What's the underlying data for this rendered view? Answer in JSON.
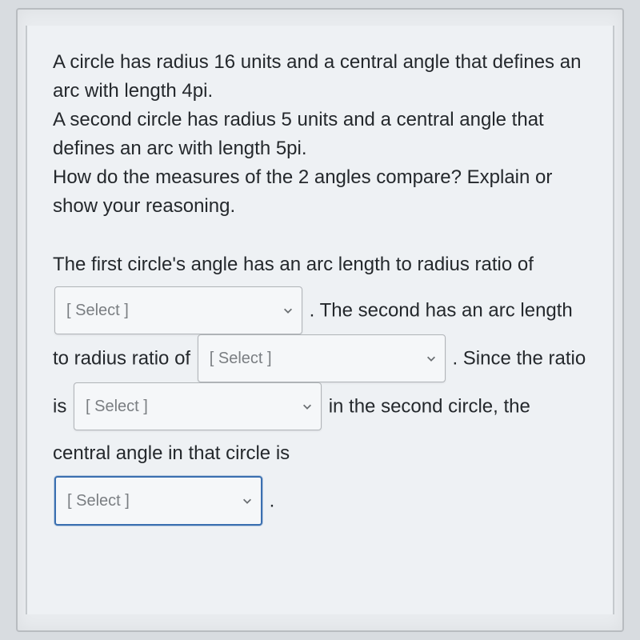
{
  "question": {
    "line1": "A circle has radius 16 units and a central angle that defines an arc with length 4pi.",
    "line2": "A second circle has radius 5 units and a central angle that defines an arc with length 5pi.",
    "line3": "How do the measures of the 2 angles compare? Explain or show your reasoning."
  },
  "answer": {
    "seg1": "The first circle's angle has an arc length to radius ratio of",
    "select1_placeholder": "[ Select ]",
    "seg2": ". The second has an arc length to radius ratio of",
    "select2_placeholder": "[ Select ]",
    "seg3": ". Since the ratio is",
    "select3_placeholder": "[ Select ]",
    "seg4": "in the second circle, the central angle in that circle is",
    "select4_placeholder": "[ Select ]",
    "seg5": "."
  }
}
